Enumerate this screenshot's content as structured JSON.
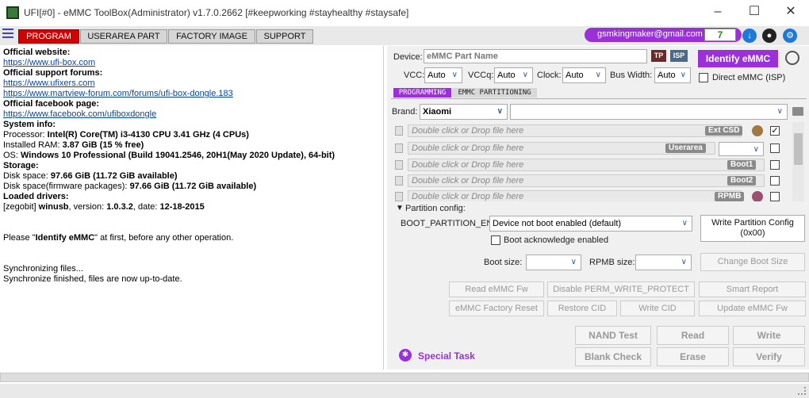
{
  "window": {
    "title": "UFI[#0] - eMMC ToolBox(Administrator) v1.7.0.2662 [#keepworking #stayhealthy #staysafe]"
  },
  "menu": {
    "tabs": [
      "PROGRAM",
      "USERAREA PART",
      "FACTORY IMAGE",
      "SUPPORT"
    ],
    "account_email": "gsmkingmaker@gmail.com",
    "account_count": "7"
  },
  "log": {
    "lines": [
      {
        "text": "Official website:",
        "style": "bold"
      },
      {
        "text": "https://www.ufi-box.com",
        "style": "link"
      },
      {
        "text": "Official support forums:",
        "style": "bold"
      },
      {
        "text": "https://www.ufixers.com",
        "style": "link"
      },
      {
        "text": "https://www.martview-forum.com/forums/ufi-box-dongle.183",
        "style": "link"
      },
      {
        "text": "Official facebook page:",
        "style": "bold"
      },
      {
        "text": "https://www.facebook.com/ufiboxdongle",
        "style": "link"
      },
      {
        "text": "System info:",
        "style": "bold"
      }
    ],
    "processor_label": "Processor: ",
    "processor_value": "Intel(R) Core(TM) i3-4130 CPU 3.41 GHz (4 CPUs)",
    "ram_label": "Installed RAM: ",
    "ram_value": "3.87 GiB (15 % free)",
    "os_label": "OS: ",
    "os_value": "Windows 10 Professional (Build 19041.2546, 20H1(May 2020 Update), 64-bit)",
    "storage_header": "Storage:",
    "disk_label": "Disk space: ",
    "disk_value": "97.66 GiB (11.72 GiB available)",
    "diskfw_label": "Disk space(firmware packages): ",
    "diskfw_value": "97.66 GiB (11.72 GiB available)",
    "drivers_header": "Loaded drivers:",
    "driver_prefix": "[zegobit] ",
    "driver_name": "winusb",
    "driver_version_label": ", version: ",
    "driver_version": "1.0.3.2",
    "driver_date_label": ", date: ",
    "driver_date": "12-18-2015",
    "please_pre": "Please \"",
    "please_bold": "Identify eMMC",
    "please_post": "\" at first, before any other operation.",
    "sync1": "Synchronizing files...",
    "sync2": "Synchronize finished, files are now up-to-date."
  },
  "device": {
    "device_label": "Device:",
    "device_placeholder": "eMMC Part Name",
    "tp": "TP",
    "isp": "ISP",
    "identify": "Identify eMMC",
    "vcc_label": "VCC:",
    "vcc_value": "Auto",
    "vccq_label": "VCCq:",
    "vccq_value": "Auto",
    "clock_label": "Clock:",
    "clock_value": "Auto",
    "bus_label": "Bus Width:",
    "bus_value": "Auto",
    "direct": "Direct eMMC (ISP)"
  },
  "subtabs": [
    "PROGRAMMING",
    "EMMC PARTITIONING"
  ],
  "brand": {
    "label": "Brand:",
    "value": "Xiaomi",
    "model_value": ""
  },
  "files": [
    {
      "placeholder": "Double click or Drop file here",
      "tag": "Ext CSD",
      "checked": true
    },
    {
      "placeholder": "Double click or Drop file here",
      "tag": "Userarea",
      "checked": false
    },
    {
      "placeholder": "Double click or Drop file here",
      "tag": "Boot1",
      "checked": false
    },
    {
      "placeholder": "Double click or Drop file here",
      "tag": "Boot2",
      "checked": false
    },
    {
      "placeholder": "Double click or Drop file here",
      "tag": "RPMB",
      "checked": false
    }
  ],
  "partition": {
    "header": "Partition config:",
    "boot_label": "BOOT_PARTITION_EN",
    "boot_value": "Device not boot enabled (default)",
    "ack": "Boot acknowledge enabled",
    "write_cfg_line1": "Write Partition Config",
    "write_cfg_line2": "(0x00)",
    "boot_size_label": "Boot size:",
    "rpmb_size_label": "RPMB size:",
    "change_boot": "Change Boot Size"
  },
  "actions": {
    "read_fw": "Read eMMC Fw",
    "disable_perm": "Disable PERM_WRITE_PROTECT",
    "smart": "Smart Report",
    "factory_reset": "eMMC Factory Reset",
    "restore_cid": "Restore CID",
    "write_cid": "Write CID",
    "update_fw": "Update eMMC Fw",
    "nand_test": "NAND Test",
    "read": "Read",
    "write": "Write",
    "blank_check": "Blank Check",
    "erase": "Erase",
    "verify": "Verify",
    "special_task": "Special Task"
  },
  "colors": {
    "accent": "#9b30d9",
    "program_tab": "#d40000",
    "link": "#0645ad",
    "count": "#2a8a2a"
  }
}
